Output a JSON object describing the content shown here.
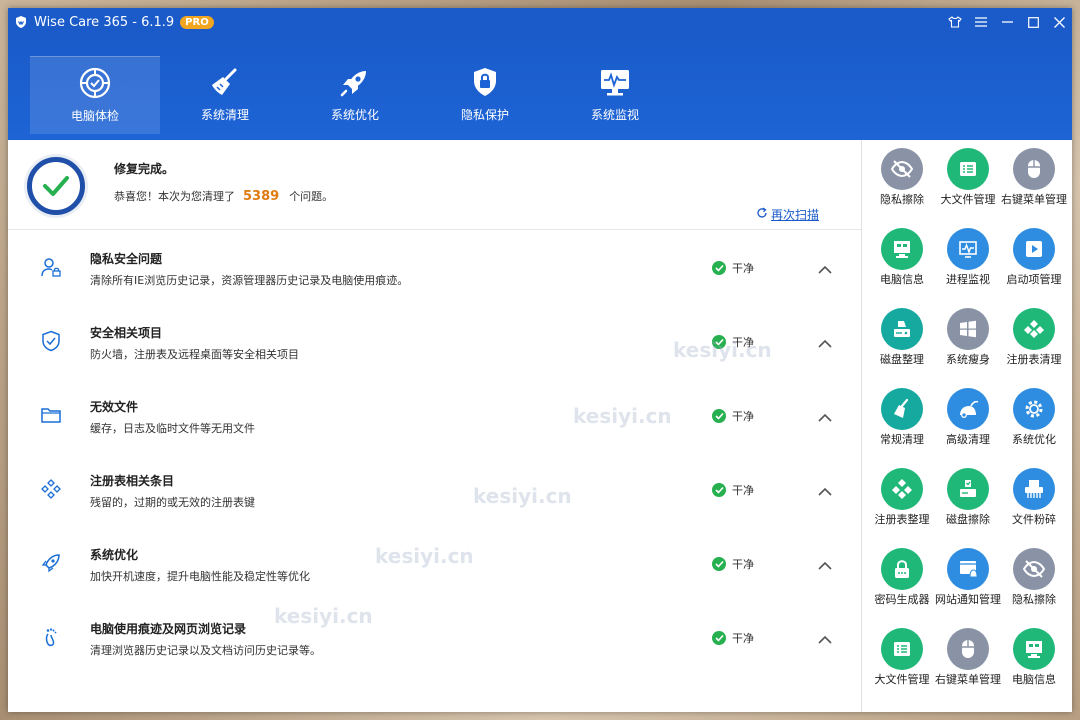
{
  "window": {
    "title": "Wise Care 365 - 6.1.9",
    "badge": "PRO"
  },
  "nav": {
    "tabs": [
      {
        "label": "电脑体检",
        "icon": "target-icon",
        "active": true
      },
      {
        "label": "系统清理",
        "icon": "broom-icon",
        "active": false
      },
      {
        "label": "系统优化",
        "icon": "rocket-icon",
        "active": false
      },
      {
        "label": "隐私保护",
        "icon": "lock-icon",
        "active": false
      },
      {
        "label": "系统监视",
        "icon": "monitor-icon",
        "active": false
      }
    ]
  },
  "summary": {
    "title": "修复完成。",
    "message_prefix": "恭喜您！本次为您清理了",
    "count": "5389",
    "message_suffix": "个问题。",
    "rescan": "再次扫描"
  },
  "rows": [
    {
      "title": "隐私安全问题",
      "desc": "清除所有IE浏览历史记录，资源管理器历史记录及电脑使用痕迹。",
      "status": "干净",
      "icon": "user-lock-icon"
    },
    {
      "title": "安全相关项目",
      "desc": "防火墙，注册表及远程桌面等安全相关项目",
      "status": "干净",
      "icon": "shield-check-icon"
    },
    {
      "title": "无效文件",
      "desc": "缓存，日志及临时文件等无用文件",
      "status": "干净",
      "icon": "folder-icon"
    },
    {
      "title": "注册表相关条目",
      "desc": "残留的，过期的或无效的注册表键",
      "status": "干净",
      "icon": "registry-icon"
    },
    {
      "title": "系统优化",
      "desc": "加快开机速度，提升电脑性能及稳定性等优化",
      "status": "干净",
      "icon": "rocket-icon"
    },
    {
      "title": "电脑使用痕迹及网页浏览记录",
      "desc": "清理浏览器历史记录以及文档访问历史记录等。",
      "status": "干净",
      "icon": "footprint-icon"
    }
  ],
  "watermark": "kesiyi.cn",
  "tools": [
    {
      "label": "隐私擦除",
      "icon": "eye-slash-icon",
      "color": "gray"
    },
    {
      "label": "大文件管理",
      "icon": "file-list-icon",
      "color": "green"
    },
    {
      "label": "右键菜单管理",
      "icon": "mouse-icon",
      "color": "gray"
    },
    {
      "label": "电脑信息",
      "icon": "computer-info-icon",
      "color": "green"
    },
    {
      "label": "进程监视",
      "icon": "process-monitor-icon",
      "color": "blue"
    },
    {
      "label": "启动项管理",
      "icon": "play-icon",
      "color": "blue"
    },
    {
      "label": "磁盘整理",
      "icon": "disk-defrag-icon",
      "color": "teal"
    },
    {
      "label": "系统瘦身",
      "icon": "windows-icon",
      "color": "gray"
    },
    {
      "label": "注册表清理",
      "icon": "registry-clean-icon",
      "color": "green"
    },
    {
      "label": "常规清理",
      "icon": "broom-icon",
      "color": "teal"
    },
    {
      "label": "高级清理",
      "icon": "vacuum-icon",
      "color": "blue"
    },
    {
      "label": "系统优化",
      "icon": "gear-icon",
      "color": "blue"
    },
    {
      "label": "注册表整理",
      "icon": "registry-defrag-icon",
      "color": "green"
    },
    {
      "label": "磁盘擦除",
      "icon": "disk-erase-icon",
      "color": "green"
    },
    {
      "label": "文件粉碎",
      "icon": "shredder-icon",
      "color": "blue"
    },
    {
      "label": "密码生成器",
      "icon": "password-icon",
      "color": "green"
    },
    {
      "label": "网站通知管理",
      "icon": "notification-icon",
      "color": "blue"
    },
    {
      "label": "隐私擦除",
      "icon": "eye-slash-icon",
      "color": "gray"
    },
    {
      "label": "大文件管理",
      "icon": "file-list-icon",
      "color": "green"
    },
    {
      "label": "右键菜单管理",
      "icon": "mouse-icon",
      "color": "gray"
    },
    {
      "label": "电脑信息",
      "icon": "computer-info-icon",
      "color": "green"
    }
  ]
}
